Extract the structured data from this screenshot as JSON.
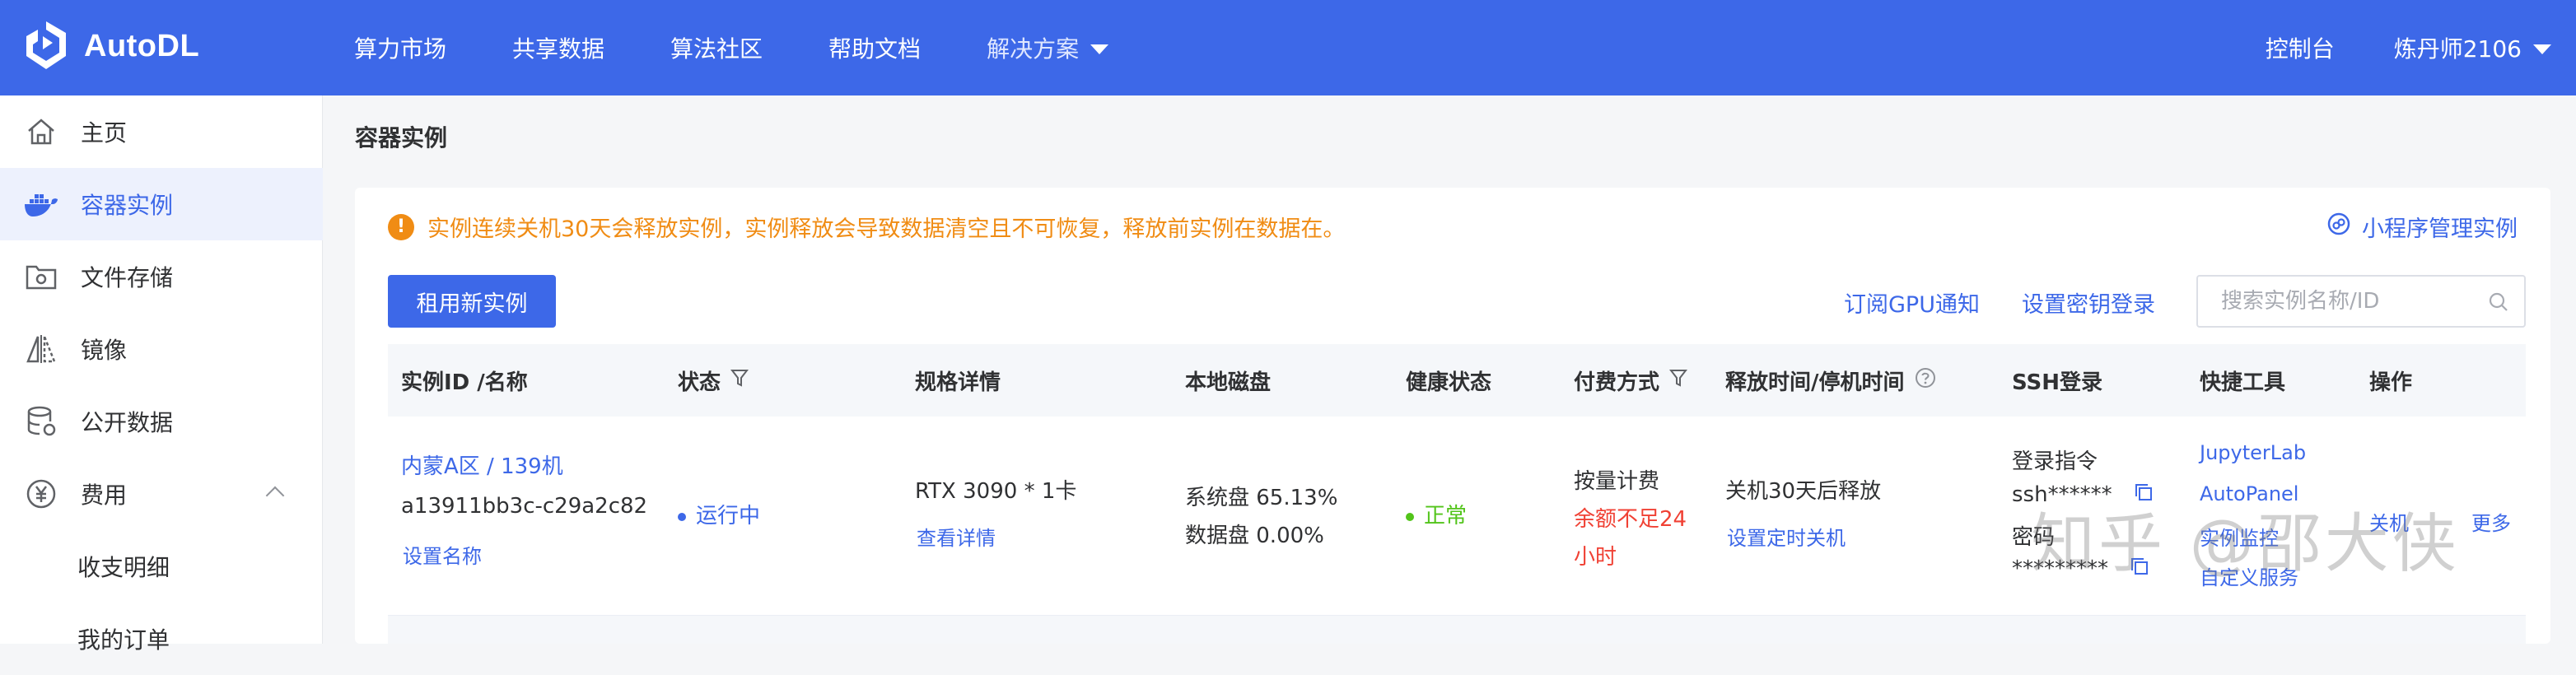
{
  "brand": {
    "name": "AutoDL",
    "accent": "#3d68e8"
  },
  "nav": {
    "items": [
      "算力市场",
      "共享数据",
      "算法社区",
      "帮助文档"
    ],
    "solutions": "解决方案",
    "console": "控制台",
    "user": "炼丹师2106"
  },
  "sidebar": {
    "home": "主页",
    "containers": "容器实例",
    "storage": "文件存储",
    "images": "镜像",
    "public_data": "公开数据",
    "billing": "费用",
    "billing_detail": "收支明细",
    "orders": "我的订单"
  },
  "page": {
    "title": "容器实例"
  },
  "alert": {
    "text": "实例连续关机30天会释放实例，实例释放会导致数据清空且不可恢复，释放前实例在数据在。"
  },
  "mini_program_link": "小程序管理实例",
  "toolbar": {
    "new_instance": "租用新实例",
    "gpu_notify": "订阅GPU通知",
    "key_login": "设置密钥登录",
    "search_placeholder": "搜索实例名称/ID"
  },
  "table": {
    "headers": {
      "id": "实例ID /名称",
      "status": "状态",
      "spec": "规格详情",
      "disk": "本地磁盘",
      "health": "健康状态",
      "billing": "付费方式",
      "release": "释放时间/停机时间",
      "ssh": "SSH登录",
      "tools": "快捷工具",
      "actions": "操作"
    },
    "row": {
      "region": "内蒙A区 / 139机",
      "instance_id": "a13911bb3c-c29a2c82",
      "set_name": "设置名称",
      "status": "运行中",
      "gpu": "RTX 3090 * 1卡",
      "view_detail": "查看详情",
      "sys_disk": "系统盘 65.13%",
      "data_disk": "数据盘 0.00%",
      "health": "正常",
      "billing_mode": "按量计费",
      "balance_warning_1": "余额不足24",
      "balance_warning_2": "小时",
      "release_text": "关机30天后释放",
      "set_shutdown": "设置定时关机",
      "ssh_cmd_label": "登录指令",
      "ssh_cmd": "ssh******",
      "ssh_pwd_label": "密码",
      "ssh_pwd": "*********",
      "tool_jupyter": "JupyterLab",
      "tool_autopanel": "AutoPanel",
      "tool_tensorboard": "实例监控",
      "tool_custom": "自定义服务",
      "action_shutdown": "关机",
      "action_more": "更多"
    }
  },
  "watermark": "知乎 @邵大侠"
}
